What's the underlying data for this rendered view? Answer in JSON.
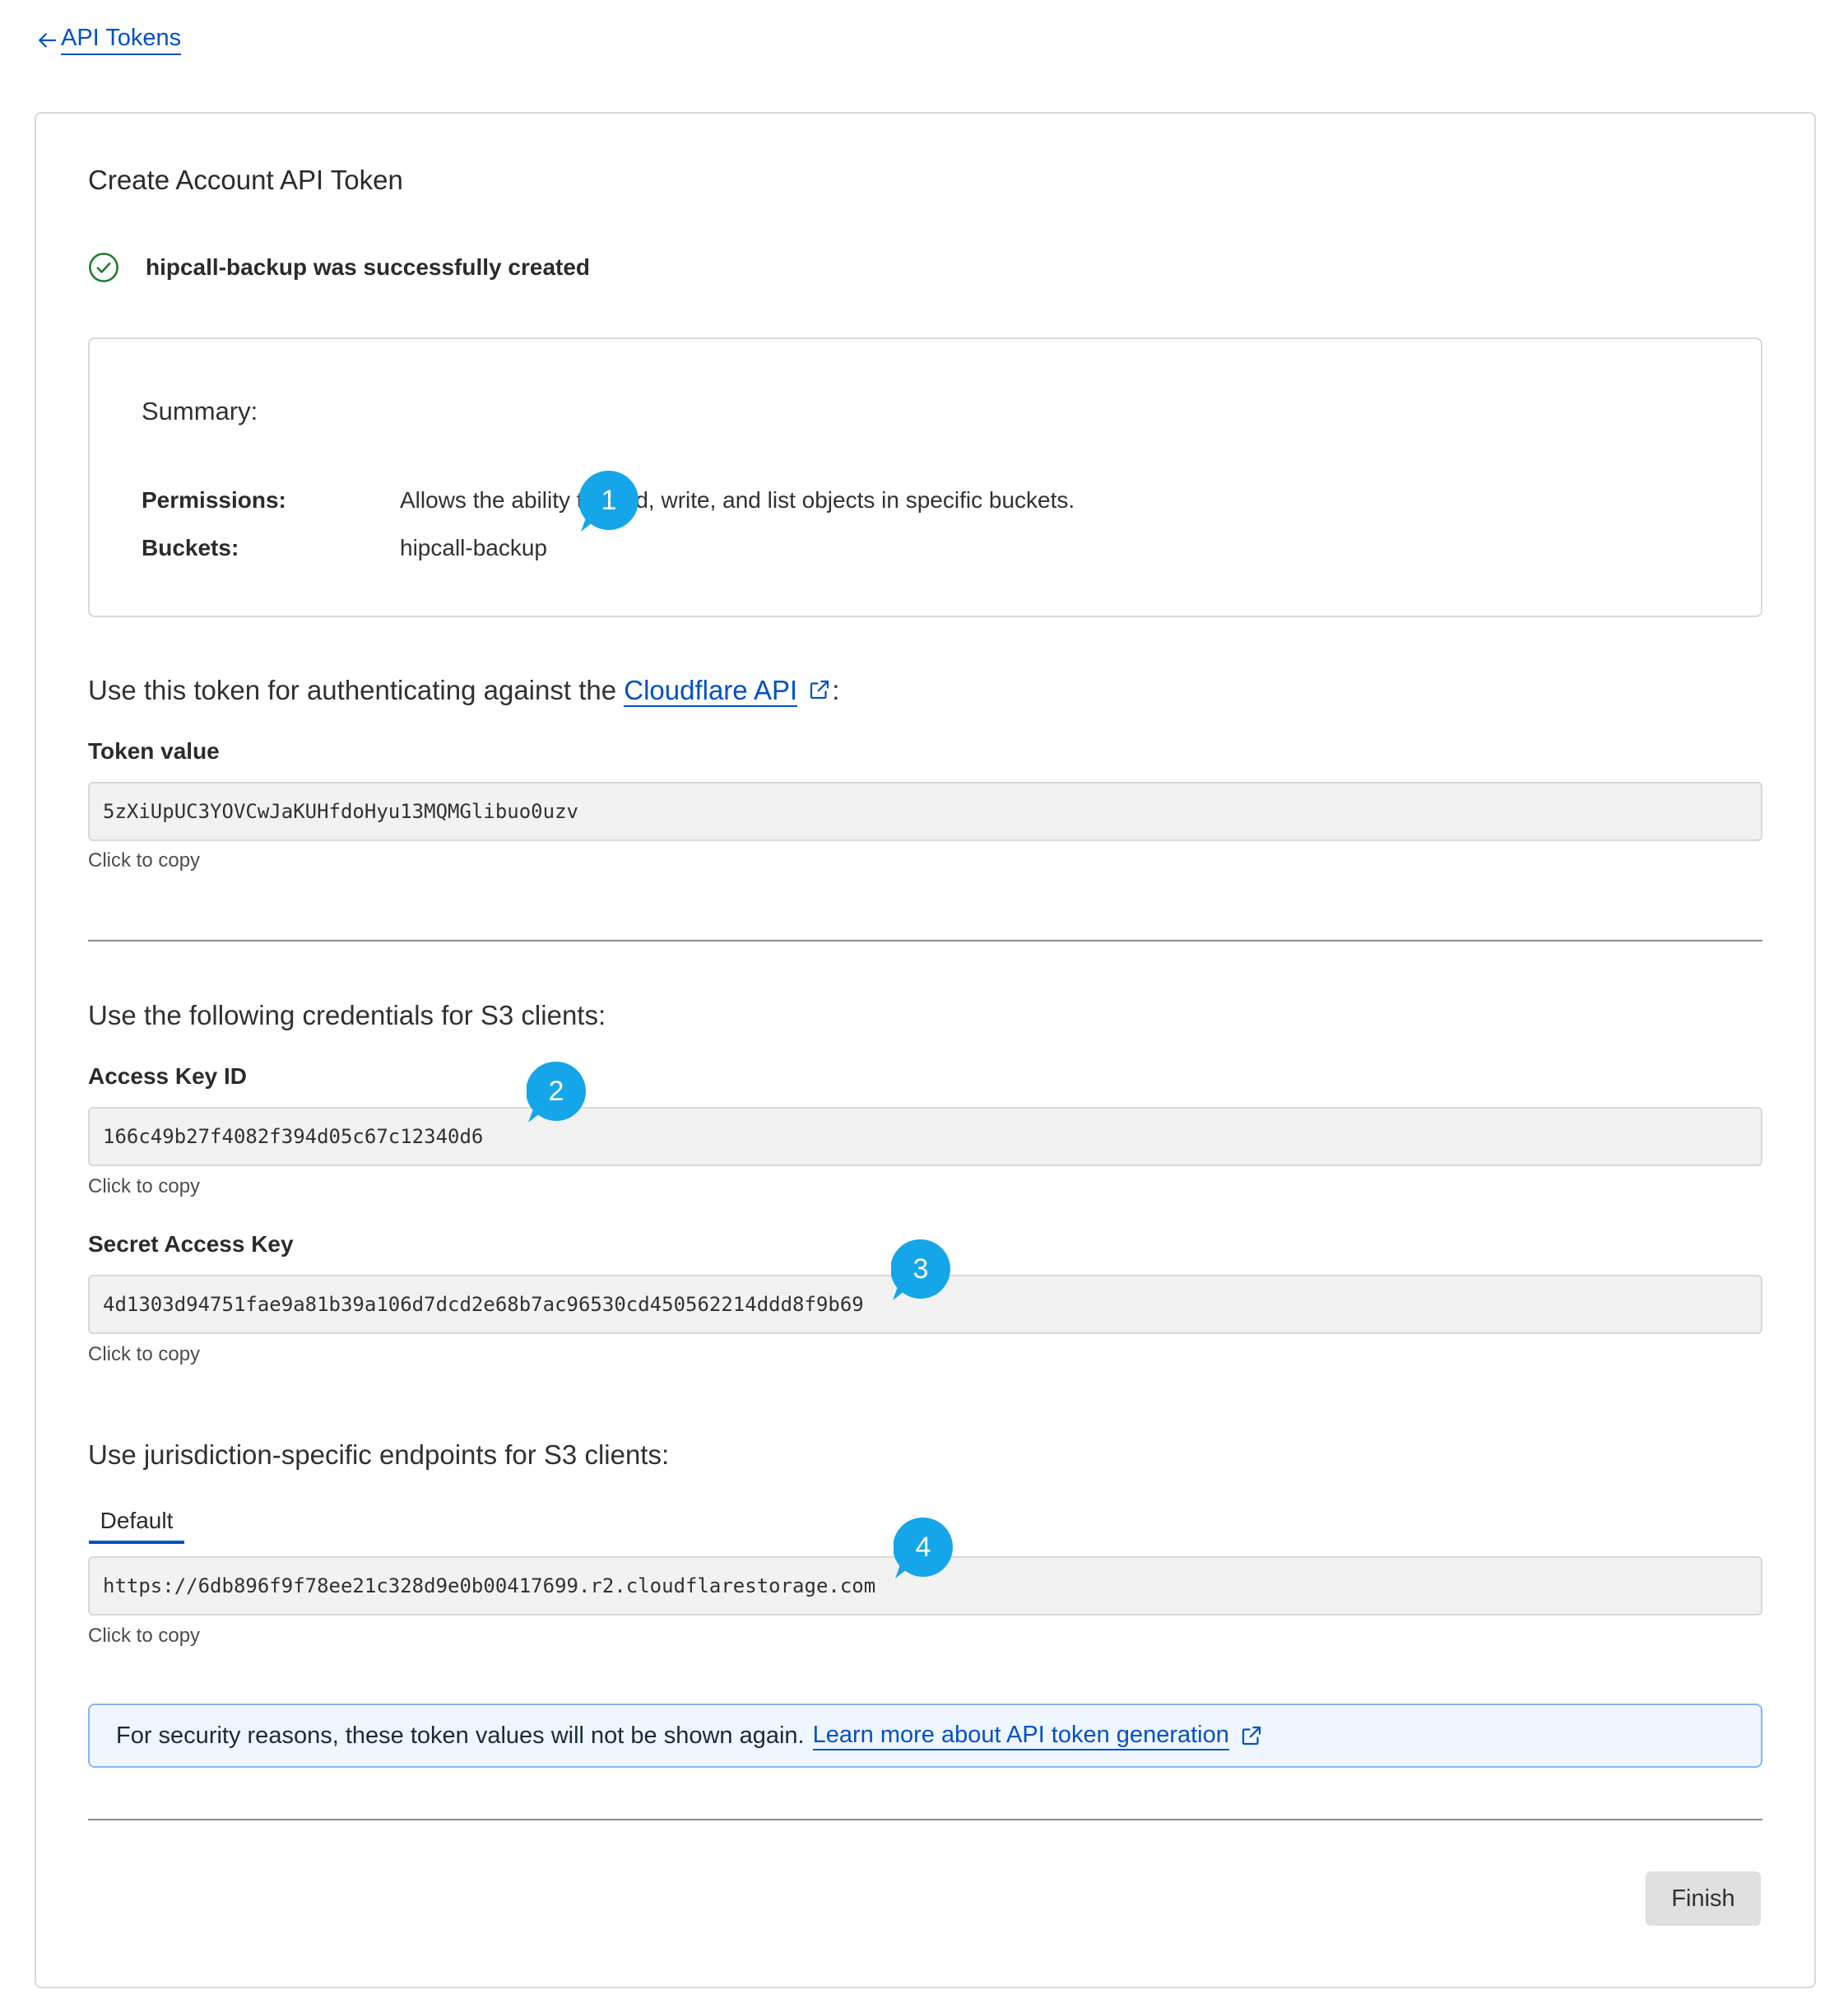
{
  "nav": {
    "back_label": "API Tokens"
  },
  "card": {
    "title": "Create Account API Token",
    "success_message": "hipcall-backup was successfully created"
  },
  "summary": {
    "heading": "Summary:",
    "permissions_label": "Permissions:",
    "permissions_value": "Allows the ability to read, write, and list objects in specific buckets.",
    "buckets_label": "Buckets:",
    "buckets_value": "hipcall-backup"
  },
  "api_section": {
    "intro_prefix": "Use this token for authenticating against the ",
    "link_label": "Cloudflare API",
    "intro_suffix": ":",
    "token_label": "Token value",
    "token_value": "5zXiUpUC3YOVCwJaKUHfdoHyu13MQMGlibuo0uzv",
    "copy_hint": "Click to copy"
  },
  "s3_section": {
    "intro": "Use the following credentials for S3 clients:",
    "access_key_label": "Access Key ID",
    "access_key_value": "166c49b27f4082f394d05c67c12340d6",
    "access_key_hint": "Click to copy",
    "secret_key_label": "Secret Access Key",
    "secret_key_value": "4d1303d94751fae9a81b39a106d7dcd2e68b7ac96530cd450562214ddd8f9b69",
    "secret_key_hint": "Click to copy"
  },
  "endpoints_section": {
    "intro": "Use jurisdiction-specific endpoints for S3 clients:",
    "tab_label": "Default",
    "endpoint_value": "https://6db896f9f78ee21c328d9e0b00417699.r2.cloudflarestorage.com",
    "endpoint_hint": "Click to copy"
  },
  "notice": {
    "text": "For security reasons, these token values will not be shown again.",
    "link_label": "Learn more about API token generation"
  },
  "actions": {
    "finish_label": "Finish"
  },
  "annotations": {
    "b1": "1",
    "b2": "2",
    "b3": "3",
    "b4": "4"
  },
  "colors": {
    "link": "#0051c3",
    "success": "#1d7a2b",
    "bubble": "#14a6e8",
    "info_bg": "#f0f6ff"
  }
}
